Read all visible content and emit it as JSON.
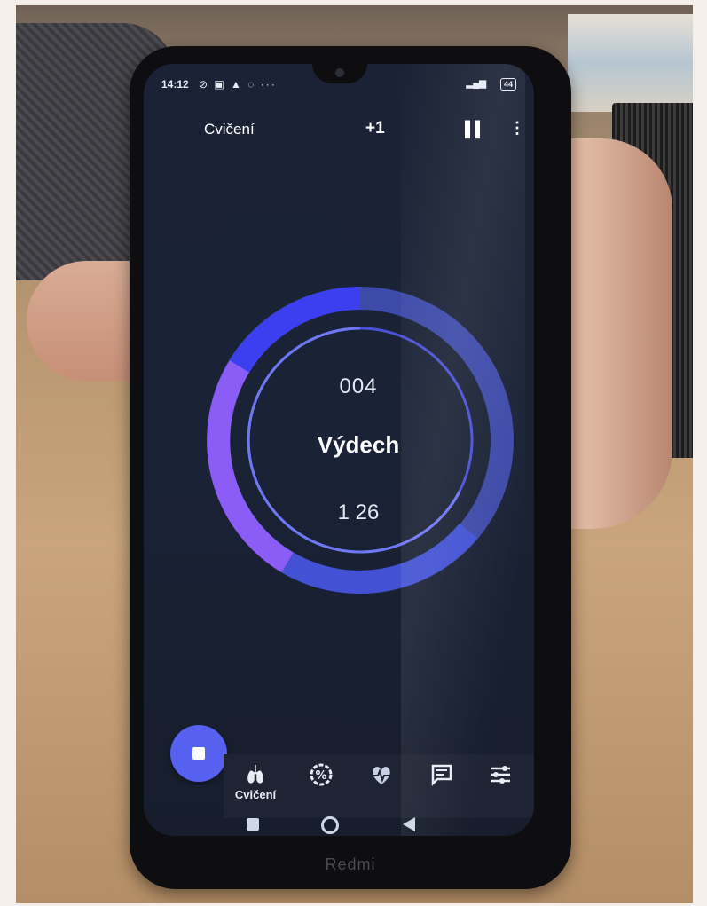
{
  "status_bar": {
    "time": "14:12",
    "battery": "44"
  },
  "app_bar": {
    "title": "Cvičení",
    "add_label": "+1"
  },
  "exercise": {
    "counter": "004",
    "phase": "Výdech",
    "elapsed": "1 26"
  },
  "bottom_nav": {
    "items": [
      {
        "label": "Cvičení",
        "icon": "lungs-icon",
        "active": true
      },
      {
        "label": "",
        "icon": "percent-badge-icon",
        "active": false
      },
      {
        "label": "",
        "icon": "heart-pulse-icon",
        "active": false
      },
      {
        "label": "",
        "icon": "message-icon",
        "active": false
      },
      {
        "label": "",
        "icon": "sliders-icon",
        "active": false
      }
    ]
  },
  "device": {
    "brand": "Redmi"
  },
  "colors": {
    "accent": "#5661f0",
    "ring_inner": "#4a52d8",
    "ring_purple": "#8b5cf6",
    "ring_track": "#3d4aa8",
    "screen_bg": "#1a2236"
  }
}
